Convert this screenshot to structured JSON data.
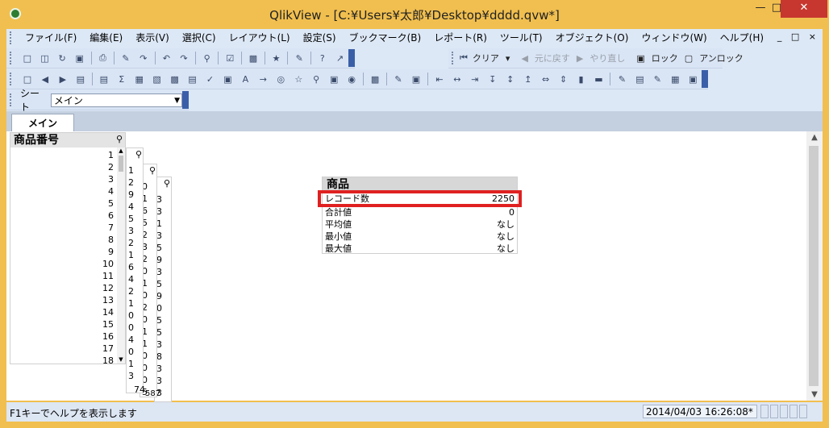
{
  "window": {
    "title": "QlikView - [C:¥Users¥太郎¥Desktop¥dddd.qvw*]"
  },
  "menu": [
    "ファイル(F)",
    "編集(E)",
    "表示(V)",
    "選択(C)",
    "レイアウト(L)",
    "設定(S)",
    "ブックマーク(B)",
    "レポート(R)",
    "ツール(T)",
    "オブジェクト(O)",
    "ウィンドウ(W)",
    "ヘルプ(H)"
  ],
  "toolbar": {
    "clear": "クリア",
    "undo_sel": "元に戻す",
    "redo_sel": "やり直し",
    "lock": "ロック",
    "unlock": "アンロック"
  },
  "sheet_selector": {
    "label": "シート",
    "value": "メイン"
  },
  "tabs": [
    {
      "label": "メイン"
    }
  ],
  "listbox_main": {
    "caption": "商品番号",
    "rows": [
      "1",
      "2",
      "3",
      "4",
      "5",
      "6",
      "7",
      "8",
      "9",
      "10",
      "11",
      "12",
      "13",
      "14",
      "15",
      "16",
      "17",
      "18"
    ]
  },
  "stacked_fragments": {
    "col2": [
      "1",
      "2",
      "9",
      "4",
      "5",
      "3",
      "2",
      "1",
      "6",
      "4",
      "2",
      "1",
      "0",
      "0",
      "4",
      "0",
      "1",
      "3"
    ],
    "col3": [
      "0",
      "1",
      "6",
      "5",
      "2",
      "3",
      "2",
      "0",
      "1",
      "0",
      "2",
      "0",
      "1",
      "1",
      "0",
      "0",
      "0",
      "5"
    ],
    "col4": [
      "3",
      "3",
      "1",
      "3",
      "5",
      "9",
      "3",
      "5",
      "9",
      "0",
      "5",
      "5",
      "3",
      "8",
      "3",
      "3",
      "3",
      "8"
    ],
    "trailing": [
      "74",
      "587"
    ]
  },
  "stats": {
    "caption": "商品",
    "rows": [
      {
        "label": "レコード数",
        "value": "2250"
      },
      {
        "label": "合計値",
        "value": "0"
      },
      {
        "label": "平均値",
        "value": "なし"
      },
      {
        "label": "最小値",
        "value": "なし"
      },
      {
        "label": "最大値",
        "value": "なし"
      }
    ]
  },
  "status": {
    "help": "F1キーでヘルプを表示します",
    "timestamp": "2014/04/03 16:26:08*"
  },
  "colors": {
    "highlight": "#e02020",
    "title_bar": "#f1bf4f",
    "close": "#c7372f"
  }
}
